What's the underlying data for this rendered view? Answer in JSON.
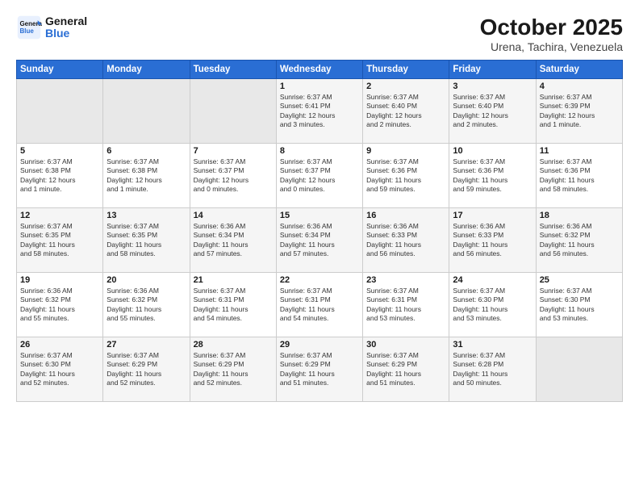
{
  "logo": {
    "line1": "General",
    "line2": "Blue"
  },
  "title": "October 2025",
  "subtitle": "Urena, Tachira, Venezuela",
  "weekdays": [
    "Sunday",
    "Monday",
    "Tuesday",
    "Wednesday",
    "Thursday",
    "Friday",
    "Saturday"
  ],
  "weeks": [
    [
      {
        "day": "",
        "info": ""
      },
      {
        "day": "",
        "info": ""
      },
      {
        "day": "",
        "info": ""
      },
      {
        "day": "1",
        "info": "Sunrise: 6:37 AM\nSunset: 6:41 PM\nDaylight: 12 hours\nand 3 minutes."
      },
      {
        "day": "2",
        "info": "Sunrise: 6:37 AM\nSunset: 6:40 PM\nDaylight: 12 hours\nand 2 minutes."
      },
      {
        "day": "3",
        "info": "Sunrise: 6:37 AM\nSunset: 6:40 PM\nDaylight: 12 hours\nand 2 minutes."
      },
      {
        "day": "4",
        "info": "Sunrise: 6:37 AM\nSunset: 6:39 PM\nDaylight: 12 hours\nand 1 minute."
      }
    ],
    [
      {
        "day": "5",
        "info": "Sunrise: 6:37 AM\nSunset: 6:38 PM\nDaylight: 12 hours\nand 1 minute."
      },
      {
        "day": "6",
        "info": "Sunrise: 6:37 AM\nSunset: 6:38 PM\nDaylight: 12 hours\nand 1 minute."
      },
      {
        "day": "7",
        "info": "Sunrise: 6:37 AM\nSunset: 6:37 PM\nDaylight: 12 hours\nand 0 minutes."
      },
      {
        "day": "8",
        "info": "Sunrise: 6:37 AM\nSunset: 6:37 PM\nDaylight: 12 hours\nand 0 minutes."
      },
      {
        "day": "9",
        "info": "Sunrise: 6:37 AM\nSunset: 6:36 PM\nDaylight: 11 hours\nand 59 minutes."
      },
      {
        "day": "10",
        "info": "Sunrise: 6:37 AM\nSunset: 6:36 PM\nDaylight: 11 hours\nand 59 minutes."
      },
      {
        "day": "11",
        "info": "Sunrise: 6:37 AM\nSunset: 6:36 PM\nDaylight: 11 hours\nand 58 minutes."
      }
    ],
    [
      {
        "day": "12",
        "info": "Sunrise: 6:37 AM\nSunset: 6:35 PM\nDaylight: 11 hours\nand 58 minutes."
      },
      {
        "day": "13",
        "info": "Sunrise: 6:37 AM\nSunset: 6:35 PM\nDaylight: 11 hours\nand 58 minutes."
      },
      {
        "day": "14",
        "info": "Sunrise: 6:36 AM\nSunset: 6:34 PM\nDaylight: 11 hours\nand 57 minutes."
      },
      {
        "day": "15",
        "info": "Sunrise: 6:36 AM\nSunset: 6:34 PM\nDaylight: 11 hours\nand 57 minutes."
      },
      {
        "day": "16",
        "info": "Sunrise: 6:36 AM\nSunset: 6:33 PM\nDaylight: 11 hours\nand 56 minutes."
      },
      {
        "day": "17",
        "info": "Sunrise: 6:36 AM\nSunset: 6:33 PM\nDaylight: 11 hours\nand 56 minutes."
      },
      {
        "day": "18",
        "info": "Sunrise: 6:36 AM\nSunset: 6:32 PM\nDaylight: 11 hours\nand 56 minutes."
      }
    ],
    [
      {
        "day": "19",
        "info": "Sunrise: 6:36 AM\nSunset: 6:32 PM\nDaylight: 11 hours\nand 55 minutes."
      },
      {
        "day": "20",
        "info": "Sunrise: 6:36 AM\nSunset: 6:32 PM\nDaylight: 11 hours\nand 55 minutes."
      },
      {
        "day": "21",
        "info": "Sunrise: 6:37 AM\nSunset: 6:31 PM\nDaylight: 11 hours\nand 54 minutes."
      },
      {
        "day": "22",
        "info": "Sunrise: 6:37 AM\nSunset: 6:31 PM\nDaylight: 11 hours\nand 54 minutes."
      },
      {
        "day": "23",
        "info": "Sunrise: 6:37 AM\nSunset: 6:31 PM\nDaylight: 11 hours\nand 53 minutes."
      },
      {
        "day": "24",
        "info": "Sunrise: 6:37 AM\nSunset: 6:30 PM\nDaylight: 11 hours\nand 53 minutes."
      },
      {
        "day": "25",
        "info": "Sunrise: 6:37 AM\nSunset: 6:30 PM\nDaylight: 11 hours\nand 53 minutes."
      }
    ],
    [
      {
        "day": "26",
        "info": "Sunrise: 6:37 AM\nSunset: 6:30 PM\nDaylight: 11 hours\nand 52 minutes."
      },
      {
        "day": "27",
        "info": "Sunrise: 6:37 AM\nSunset: 6:29 PM\nDaylight: 11 hours\nand 52 minutes."
      },
      {
        "day": "28",
        "info": "Sunrise: 6:37 AM\nSunset: 6:29 PM\nDaylight: 11 hours\nand 52 minutes."
      },
      {
        "day": "29",
        "info": "Sunrise: 6:37 AM\nSunset: 6:29 PM\nDaylight: 11 hours\nand 51 minutes."
      },
      {
        "day": "30",
        "info": "Sunrise: 6:37 AM\nSunset: 6:29 PM\nDaylight: 11 hours\nand 51 minutes."
      },
      {
        "day": "31",
        "info": "Sunrise: 6:37 AM\nSunset: 6:28 PM\nDaylight: 11 hours\nand 50 minutes."
      },
      {
        "day": "",
        "info": ""
      }
    ]
  ]
}
